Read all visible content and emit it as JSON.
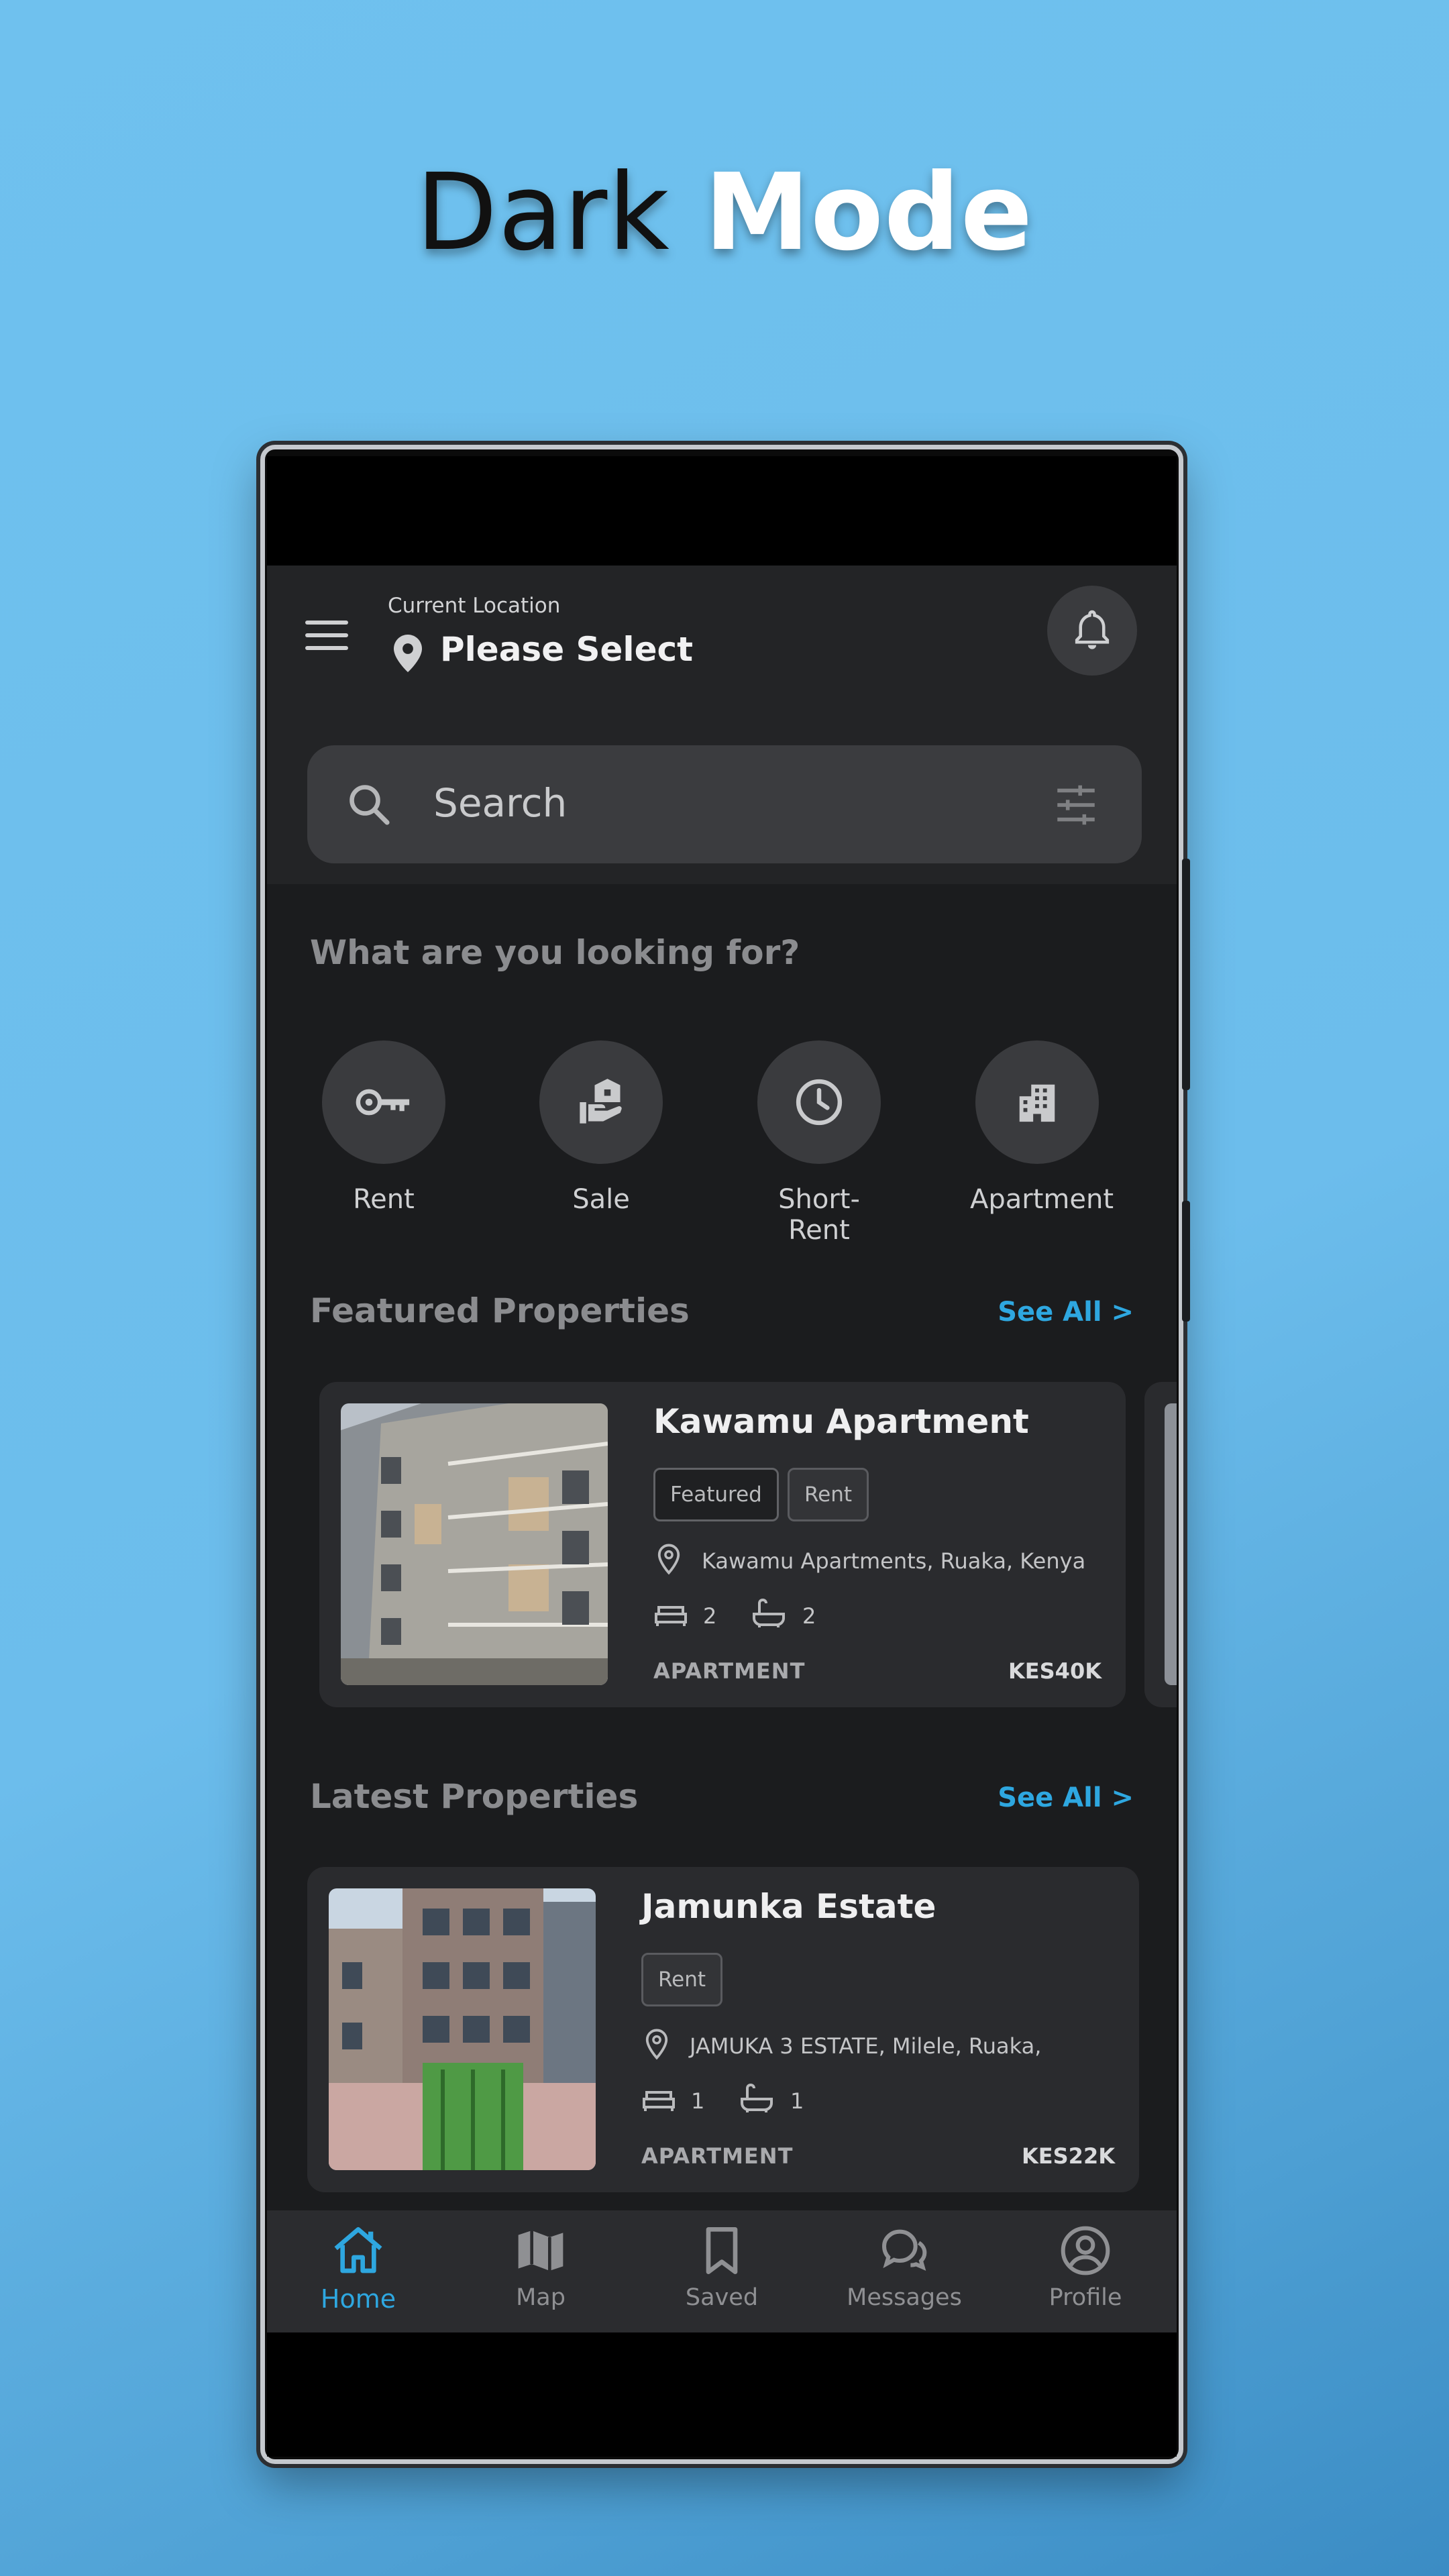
{
  "headline": {
    "word1": "Dark",
    "word2": "Mode"
  },
  "header": {
    "location_caption": "Current Location",
    "location_value": "Please Select"
  },
  "search": {
    "placeholder": "Search"
  },
  "categories_section": {
    "title": "What are you looking for?",
    "items": [
      {
        "label": "Rent",
        "icon": "key-icon"
      },
      {
        "label": "Sale",
        "icon": "house-in-hand-icon"
      },
      {
        "label": "Short-Rent",
        "icon": "clock-icon"
      },
      {
        "label": "Apartment",
        "icon": "building-icon"
      }
    ]
  },
  "featured": {
    "title": "Featured Properties",
    "see_all": "See All >",
    "card": {
      "name": "Kawamu Apartment",
      "chips": [
        "Featured",
        "Rent"
      ],
      "address": "Kawamu Apartments, Ruaka, Kenya",
      "beds": "2",
      "baths": "2",
      "type": "APARTMENT",
      "price": "KES40K"
    }
  },
  "latest": {
    "title": "Latest Properties",
    "see_all": "See All >",
    "card": {
      "name": "Jamunka Estate",
      "chips": [
        "Rent"
      ],
      "address": "JAMUKA 3 ESTATE, Milele, Ruaka,",
      "beds": "1",
      "baths": "1",
      "type": "APARTMENT",
      "price": "KES22K"
    }
  },
  "nav": {
    "items": [
      {
        "label": "Home",
        "icon": "home-icon",
        "active": true
      },
      {
        "label": "Map",
        "icon": "map-icon",
        "active": false
      },
      {
        "label": "Saved",
        "icon": "bookmark-icon",
        "active": false
      },
      {
        "label": "Messages",
        "icon": "chat-bubbles-icon",
        "active": false
      },
      {
        "label": "Profile",
        "icon": "user-circle-icon",
        "active": false
      }
    ]
  },
  "colors": {
    "accent": "#2ea7e0",
    "background_gradient_start": "#6fc1ee",
    "screen_background": "#1b1c1e"
  }
}
